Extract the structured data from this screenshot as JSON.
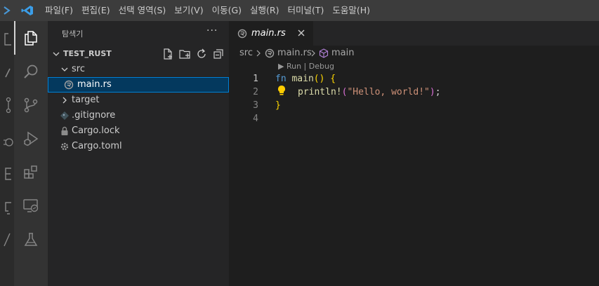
{
  "menu": [
    "파일(F)",
    "편집(E)",
    "선택 영역(S)",
    "보기(V)",
    "이동(G)",
    "실행(R)",
    "터미널(T)",
    "도움말(H)"
  ],
  "sidebar": {
    "title": "탐색기",
    "more": "···",
    "section": "TEST_RUST",
    "tree": [
      {
        "label": "src",
        "kind": "folder-open"
      },
      {
        "label": "main.rs",
        "kind": "rust-file",
        "selected": true
      },
      {
        "label": "target",
        "kind": "folder-closed"
      },
      {
        "label": ".gitignore",
        "kind": "git-file"
      },
      {
        "label": "Cargo.lock",
        "kind": "lock-file"
      },
      {
        "label": "Cargo.toml",
        "kind": "gear-file"
      }
    ]
  },
  "tab": {
    "label": "main.rs"
  },
  "breadcrumb": {
    "folder": "src",
    "file": "main.rs",
    "symbol": "main"
  },
  "editor": {
    "codelens": "▶ Run | Debug",
    "line_numbers": [
      "1",
      "2",
      "3",
      "4"
    ],
    "line1": {
      "kw": "fn",
      "name": "main",
      "parens": "()",
      "brace": "{"
    },
    "line2": {
      "macro": "println!",
      "open": "(",
      "string": "\"Hello, world!\"",
      "close": ")",
      "semi": ";"
    },
    "line3": {
      "brace": "}"
    }
  },
  "colors": {
    "accent": "#007acc",
    "selection": "#04395e",
    "keyword": "#569cd6",
    "function": "#dcdcaa",
    "string": "#ce9178"
  }
}
